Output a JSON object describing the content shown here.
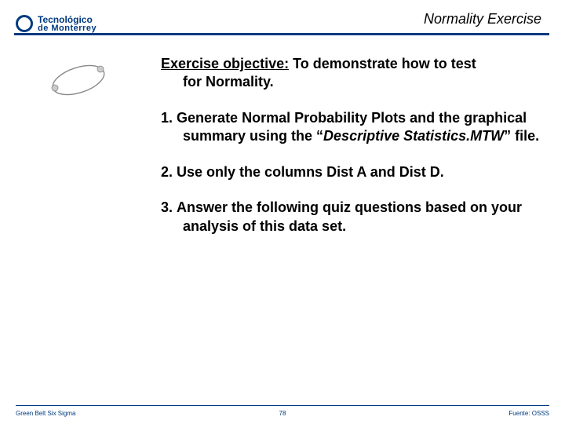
{
  "logo": {
    "line1": "Tecnológico",
    "line2": "de Monterrey"
  },
  "title": "Normality Exercise",
  "objective": {
    "label": "Exercise objective:",
    "text_lead": "To demonstrate how to test",
    "text_rest": "for Normality."
  },
  "steps": [
    {
      "num": "1.",
      "pre": "Generate Normal Probability Plots and the graphical summary using the “",
      "ital": "Descriptive Statistics.MTW",
      "post": "” file."
    },
    {
      "num": "2.",
      "pre": "Use only the columns Dist A and Dist D.",
      "ital": "",
      "post": ""
    },
    {
      "num": "3.",
      "pre": "Answer the following quiz questions based on your analysis of this data set.",
      "ital": "",
      "post": ""
    }
  ],
  "footer": {
    "left": "Green Belt Six Sigma",
    "page": "78",
    "right": "Fuente: OSSS"
  }
}
